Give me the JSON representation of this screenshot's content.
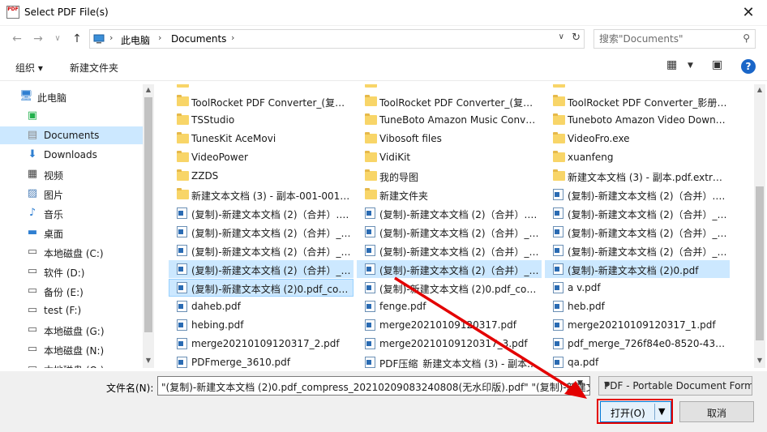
{
  "window": {
    "title": "Select PDF File(s)",
    "close_glyph": "✕"
  },
  "nav": {
    "back": "←",
    "forward": "→",
    "recent": "∨",
    "up": "↑",
    "path": [
      "此电脑",
      "Documents"
    ],
    "search_placeholder": "搜索\"Documents\""
  },
  "toolbar": {
    "organize": "组织 ▾",
    "new_folder": "新建文件夹"
  },
  "sidebar": {
    "items": [
      {
        "label": "此电脑",
        "icon": "pc-icon"
      },
      {
        "label": "",
        "icon": "green-app-icon"
      },
      {
        "label": "Documents",
        "icon": "documents-icon"
      },
      {
        "label": "Downloads",
        "icon": "downloads-icon"
      },
      {
        "label": "视频",
        "icon": "video-icon"
      },
      {
        "label": "图片",
        "icon": "pictures-icon"
      },
      {
        "label": "音乐",
        "icon": "music-icon"
      },
      {
        "label": "桌面",
        "icon": "desktop-icon"
      },
      {
        "label": "本地磁盘 (C:)",
        "icon": "drive-icon"
      },
      {
        "label": "软件 (D:)",
        "icon": "drive-icon"
      },
      {
        "label": "备份 (E:)",
        "icon": "drive-icon"
      },
      {
        "label": "test (F:)",
        "icon": "drive-icon"
      },
      {
        "label": "本地磁盘 (G:)",
        "icon": "drive-icon"
      },
      {
        "label": "本地磁盘 (N:)",
        "icon": "drive-icon"
      },
      {
        "label": "本地磁盘 (O:)",
        "icon": "drive-icon"
      }
    ]
  },
  "files": {
    "col1": [
      {
        "name": "",
        "type": "folder"
      },
      {
        "name": "ToolRocket PDF Converter_(复制)...",
        "type": "folder"
      },
      {
        "name": "TSStudio",
        "type": "folder"
      },
      {
        "name": "TunesKit AceMovi",
        "type": "folder"
      },
      {
        "name": "VideoPower",
        "type": "folder"
      },
      {
        "name": "ZZDS",
        "type": "folder"
      },
      {
        "name": "新建文本文档 (3) - 副本-001-001.p...",
        "type": "folder"
      },
      {
        "name": "(复制)-新建文本文档 (2)（合并）.p...",
        "type": "pdf"
      },
      {
        "name": "(复制)-新建文本文档 (2)（合并）_c...",
        "type": "pdf"
      },
      {
        "name": "(复制)-新建文本文档 (2)（合并）_加...",
        "type": "pdf"
      },
      {
        "name": "(复制)-新建文本文档 (2)（合并）_已...",
        "type": "pdf"
      },
      {
        "name": "(复制)-新建文本文档 (2)0.pdf_com...",
        "type": "pdf"
      },
      {
        "name": "daheb.pdf",
        "type": "pdf"
      },
      {
        "name": "hebing.pdf",
        "type": "pdf"
      },
      {
        "name": "merge20210109120317_2.pdf",
        "type": "pdf"
      },
      {
        "name": "PDFmerge_3610.pdf",
        "type": "pdf"
      }
    ],
    "col2": [
      {
        "name": "",
        "type": "folder"
      },
      {
        "name": "ToolRocket PDF Converter_(复制)...",
        "type": "folder"
      },
      {
        "name": "TuneBoto Amazon Music Conver...",
        "type": "folder"
      },
      {
        "name": "Vibosoft files",
        "type": "folder"
      },
      {
        "name": "VidiKit",
        "type": "folder"
      },
      {
        "name": "我的导图",
        "type": "folder"
      },
      {
        "name": "新建文件夹",
        "type": "folder"
      },
      {
        "name": "(复制)-新建文本文档 (2)（合并）.p...",
        "type": "pdf"
      },
      {
        "name": "(复制)-新建文本文档 (2)（合并）_加...",
        "type": "pdf"
      },
      {
        "name": "(复制)-新建文本文档 (2)（合并）_加...",
        "type": "pdf"
      },
      {
        "name": "(复制)-新建文本文档 (2)（合并）_已...",
        "type": "pdf"
      },
      {
        "name": "(复制)-新建文本文档 (2)0.pdf_com...",
        "type": "pdf"
      },
      {
        "name": "fenge.pdf",
        "type": "pdf"
      },
      {
        "name": "merge20210109120317.pdf",
        "type": "pdf"
      },
      {
        "name": "merge20210109120317_3.pdf",
        "type": "pdf"
      },
      {
        "name": "PDF压缩_新建文本文档 (3) - 副本...",
        "type": "pdf"
      }
    ],
    "col3": [
      {
        "name": "",
        "type": "folder"
      },
      {
        "name": "ToolRocket PDF Converter_影册_s...",
        "type": "folder"
      },
      {
        "name": "Tuneboto Amazon Video Downlo...",
        "type": "folder"
      },
      {
        "name": "VideoFro.exe",
        "type": "folder"
      },
      {
        "name": "xuanfeng",
        "type": "folder"
      },
      {
        "name": "新建文本文档 (3) - 副本.pdf.extract...",
        "type": "folder"
      },
      {
        "name": "(复制)-新建文本文档 (2)（合并）.pdf",
        "type": "pdf"
      },
      {
        "name": "(复制)-新建文本文档 (2)（合并）_1...",
        "type": "pdf"
      },
      {
        "name": "(复制)-新建文本文档 (2)（合并）_加...",
        "type": "pdf"
      },
      {
        "name": "(复制)-新建文本文档 (2)（合并）_加...",
        "type": "pdf"
      },
      {
        "name": "(复制)-新建文本文档 (2)0.pdf",
        "type": "pdf"
      },
      {
        "name": "a v.pdf",
        "type": "pdf"
      },
      {
        "name": "heb.pdf",
        "type": "pdf"
      },
      {
        "name": "merge20210109120317_1.pdf",
        "type": "pdf"
      },
      {
        "name": "pdf_merge_726f84e0-8520-4335-...",
        "type": "pdf"
      },
      {
        "name": "qa.pdf",
        "type": "pdf"
      }
    ]
  },
  "bottom": {
    "filename_label": "文件名(N):",
    "filename_value": "\"(复制)-新建文本文档 (2)0.pdf_compress_20210209083240808(无水印版).pdf\" \"(复制)-新建文本文档",
    "filetype": "PDF - Portable Document Format (*.pdf)",
    "open_label": "打开(O)",
    "cancel_label": "取消"
  },
  "colors": {
    "selection": "#cce8ff",
    "accent": "#0078d7",
    "annotation": "#e30000"
  }
}
